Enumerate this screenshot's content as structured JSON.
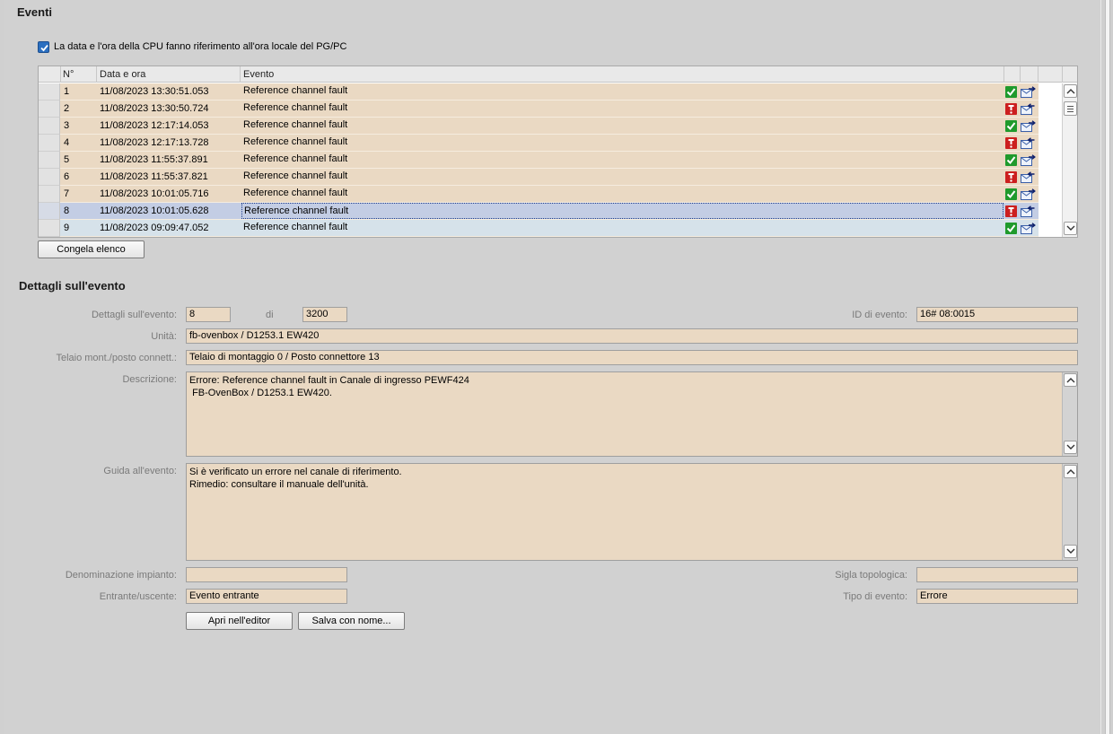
{
  "events_section": {
    "title": "Eventi",
    "checkbox_label": "La data e l'ora della CPU fanno riferimento all'ora locale del PG/PC",
    "checkbox_checked": true,
    "columns": {
      "n": "N°",
      "datetime": "Data e ora",
      "event": "Evento"
    },
    "rows": [
      {
        "n": "1",
        "datetime": "11/08/2023 13:30:51.053",
        "event": "Reference channel fault",
        "status": "ok-icon"
      },
      {
        "n": "2",
        "datetime": "11/08/2023 13:30:50.724",
        "event": "Reference channel fault",
        "status": "error-icon"
      },
      {
        "n": "3",
        "datetime": "11/08/2023 12:17:14.053",
        "event": "Reference channel fault",
        "status": "ok-icon"
      },
      {
        "n": "4",
        "datetime": "11/08/2023 12:17:13.728",
        "event": "Reference channel fault",
        "status": "error-icon"
      },
      {
        "n": "5",
        "datetime": "11/08/2023 11:55:37.891",
        "event": "Reference channel fault",
        "status": "ok-icon"
      },
      {
        "n": "6",
        "datetime": "11/08/2023 11:55:37.821",
        "event": "Reference channel fault",
        "status": "error-icon"
      },
      {
        "n": "7",
        "datetime": "11/08/2023 10:01:05.716",
        "event": "Reference channel fault",
        "status": "ok-icon"
      },
      {
        "n": "8",
        "datetime": "11/08/2023 10:01:05.628",
        "event": "Reference channel fault",
        "status": "error-icon"
      },
      {
        "n": "9",
        "datetime": "11/08/2023 09:09:47.052",
        "event": "Reference channel fault",
        "status": "ok-icon"
      }
    ],
    "selected_row": "8",
    "freeze_button": "Congela elenco"
  },
  "details": {
    "title": "Dettagli sull'evento",
    "event_details_label": "Dettagli sull'evento:",
    "event_index": "8",
    "of_label": "di",
    "event_total": "3200",
    "event_id_label": "ID di evento:",
    "event_id": "16# 08:0015",
    "unit_label": "Unità:",
    "unit": "fb-ovenbox / D1253.1 EW420",
    "rack_label": "Telaio mont./posto connett.:",
    "rack": "Telaio di montaggio 0 / Posto connettore 13",
    "description_label": "Descrizione:",
    "description": "Errore: Reference channel fault in Canale di ingresso PEWF424\n FB-OvenBox / D1253.1 EW420.",
    "guide_label": "Guida all'evento:",
    "guide": "Si è verificato un errore nel canale di riferimento.\nRimedio: consultare il manuale dell'unità.",
    "plant_label": "Denominazione impianto:",
    "plant": "",
    "topology_label": "Sigla topologica:",
    "topology": "",
    "direction_label": "Entrante/uscente:",
    "direction": "Evento entrante",
    "event_type_label": "Tipo di evento:",
    "event_type": "Errore",
    "open_editor_button": "Apri nell'editor",
    "save_as_button": "Salva con nome..."
  },
  "colors": {
    "field_background": "#ead9c3",
    "selected_row": "#c3cde4",
    "ok_icon": "#1f9a2c",
    "error_icon": "#cc1f1f"
  }
}
